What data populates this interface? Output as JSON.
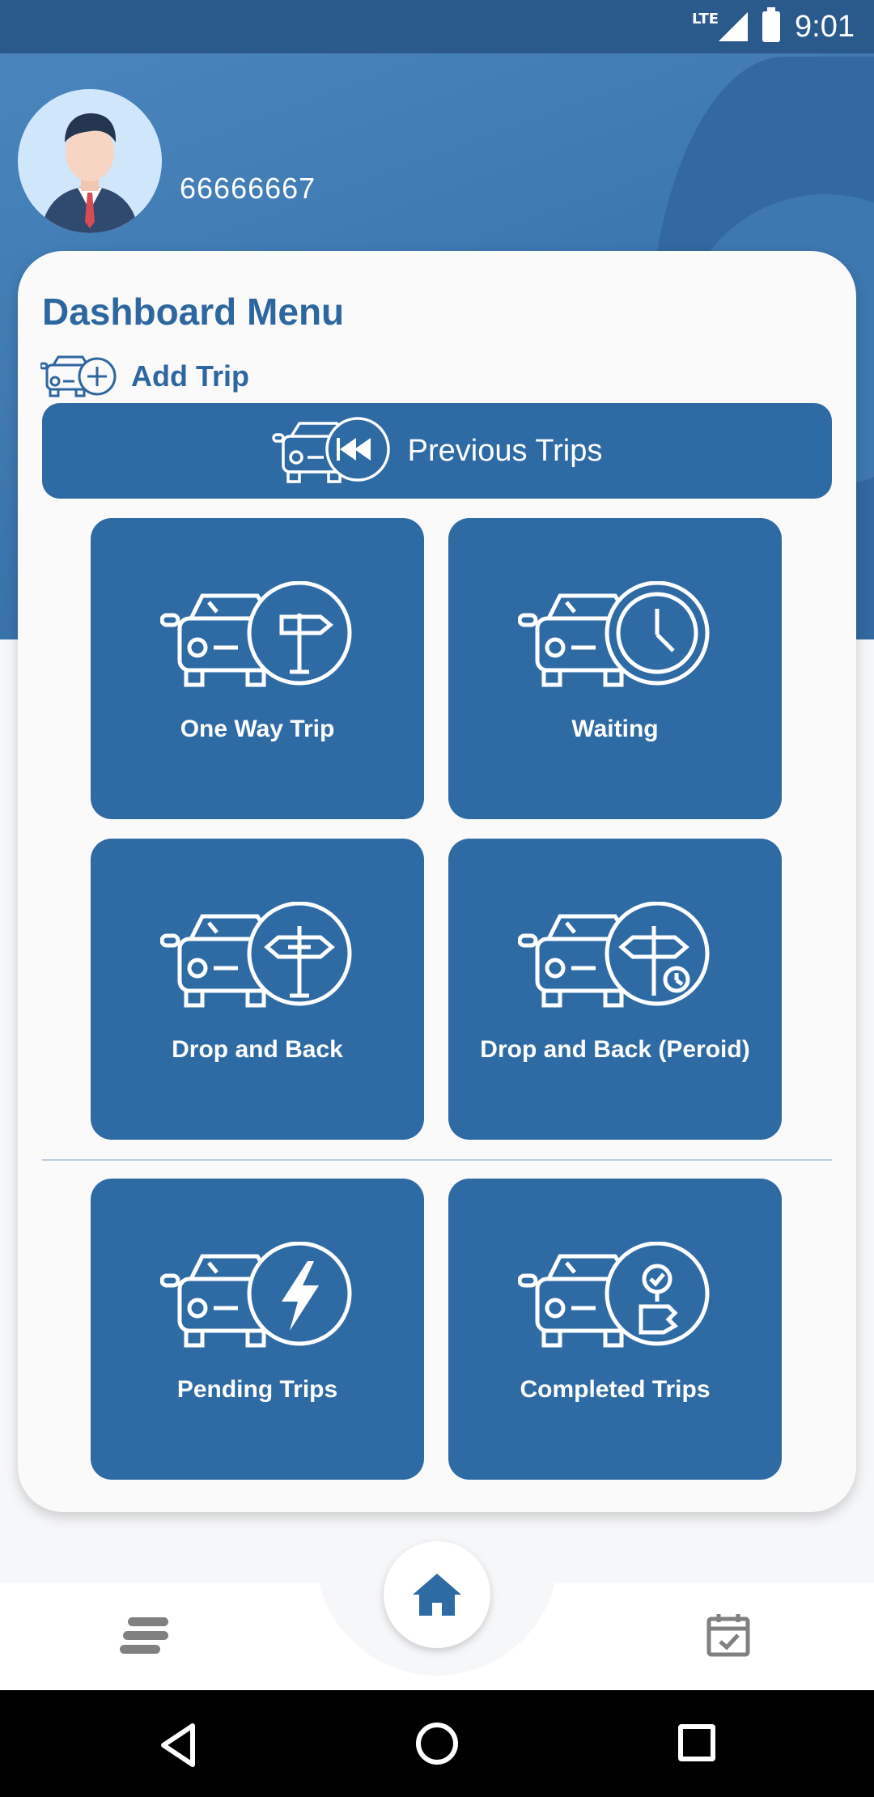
{
  "status_bar": {
    "network": "LTE",
    "time": "9:01"
  },
  "profile": {
    "username": "66666667"
  },
  "dashboard": {
    "title": "Dashboard Menu",
    "add_trip_label": "Add Trip",
    "previous_trips_label": "Previous Trips",
    "tiles": [
      {
        "label": "One Way Trip",
        "icon": "car-signpost-icon"
      },
      {
        "label": "Waiting",
        "icon": "car-clock-icon"
      },
      {
        "label": "Drop and Back",
        "icon": "car-two-way-sign-icon"
      },
      {
        "label": "Drop and Back (Peroid)",
        "icon": "car-two-way-sign-clock-icon"
      },
      {
        "label": "Pending Trips",
        "icon": "car-lightning-icon"
      },
      {
        "label": "Completed Trips",
        "icon": "car-approved-icon"
      }
    ]
  },
  "bottom_nav": {
    "left_icon": "menu-icon",
    "center_icon": "home-icon",
    "right_icon": "calendar-check-icon"
  },
  "colors": {
    "primary": "#2e6ba4",
    "header": "#3a74ad",
    "card": "#fafafa"
  }
}
